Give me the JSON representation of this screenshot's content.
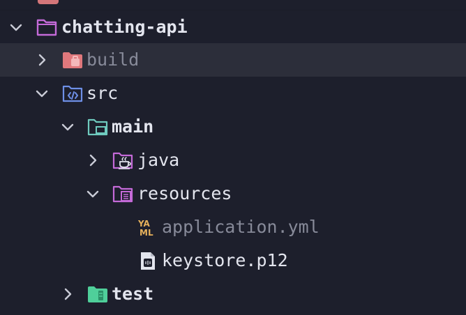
{
  "colors": {
    "background": "#1d1f2c",
    "selected_row": "#2c2e3a",
    "text": "#e3e5ee",
    "text_dim": "#878a99",
    "chevron": "#c9cbd6",
    "module_purple": "#c46ad8",
    "build_red": "#e0787c",
    "source_blue": "#6e8fe6",
    "main_teal": "#6fcbbf",
    "test_green": "#4fcf9a",
    "yaml_gold": "#e6b15c"
  },
  "tree": [
    {
      "label": "chatting-api",
      "expanded": true,
      "icon": "module-folder-icon",
      "bold": true
    },
    {
      "label": "build",
      "expanded": false,
      "icon": "excluded-folder-icon",
      "dim": true,
      "selected": true
    },
    {
      "label": "src",
      "expanded": true,
      "icon": "source-folder-icon"
    },
    {
      "label": "main",
      "expanded": true,
      "icon": "main-folder-icon",
      "bold": true
    },
    {
      "label": "java",
      "expanded": false,
      "icon": "java-folder-icon"
    },
    {
      "label": "resources",
      "expanded": true,
      "icon": "resources-folder-icon"
    },
    {
      "label": "application.yml",
      "icon": "yaml-file-icon",
      "dim": true
    },
    {
      "label": "keystore.p12",
      "icon": "keystore-file-icon"
    },
    {
      "label": "test",
      "expanded": false,
      "icon": "test-folder-icon",
      "bold": true
    }
  ]
}
